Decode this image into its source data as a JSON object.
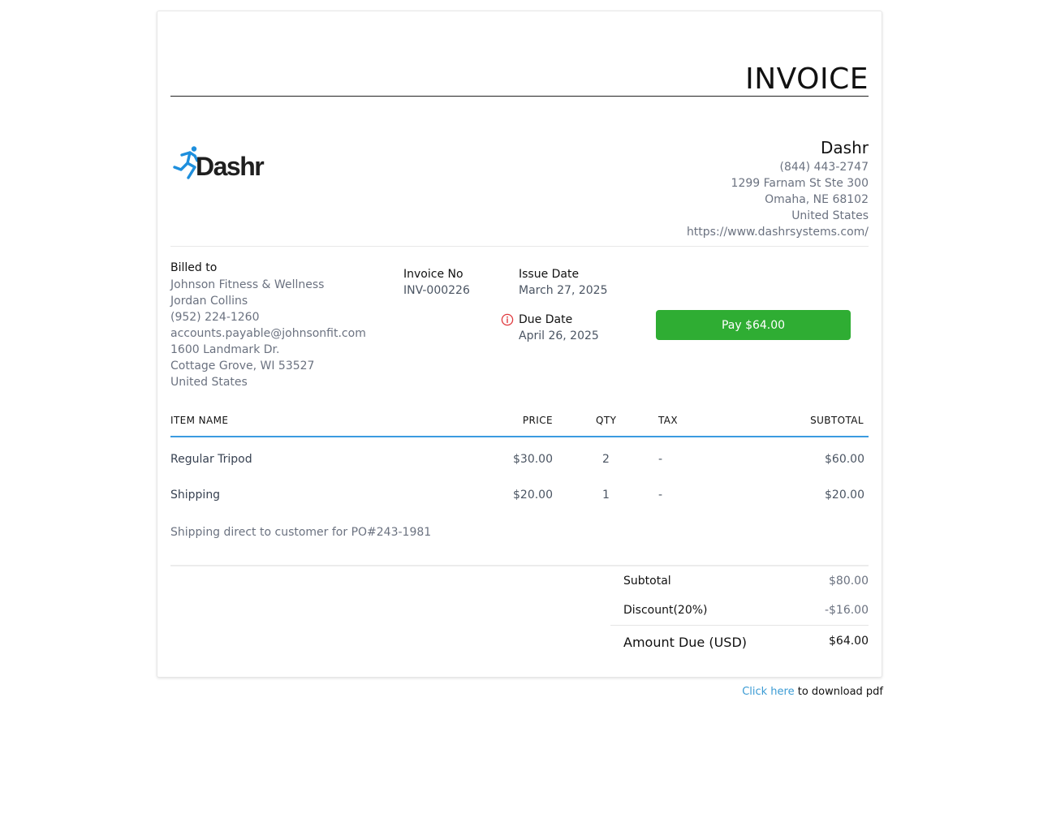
{
  "document": {
    "title": "INVOICE"
  },
  "company": {
    "logo_text": "Dashr",
    "name": "Dashr",
    "phone": "(844) 443-2747",
    "address_line1": "1299 Farnam St Ste 300",
    "address_line2": "Omaha, NE 68102",
    "country": "United States",
    "website": "https://www.dashrsystems.com/"
  },
  "billed_to": {
    "label": "Billed to",
    "company": "Johnson Fitness & Wellness",
    "contact": "Jordan Collins",
    "phone": "(952) 224-1260",
    "email": "accounts.payable@johnsonfit.com",
    "address_line1": "1600 Landmark Dr.",
    "address_line2": "Cottage Grove, WI 53527",
    "country": "United States"
  },
  "invoice": {
    "number_label": "Invoice No",
    "number": "INV-000226",
    "issue_label": "Issue Date",
    "issue_date": "March 27, 2025",
    "due_label": "Due Date",
    "due_date": "April 26, 2025",
    "pay_button": "Pay $64.00"
  },
  "table": {
    "headers": {
      "item": "ITEM NAME",
      "price": "PRICE",
      "qty": "QTY",
      "tax": "TAX",
      "subtotal": "SUBTOTAL"
    },
    "rows": [
      {
        "item": "Regular Tripod",
        "price": "$30.00",
        "qty": "2",
        "tax": "-",
        "subtotal": "$60.00"
      },
      {
        "item": "Shipping",
        "price": "$20.00",
        "qty": "1",
        "tax": "-",
        "subtotal": "$20.00"
      }
    ],
    "note": "Shipping direct to customer for PO#243-1981"
  },
  "totals": {
    "subtotal_label": "Subtotal",
    "subtotal": "$80.00",
    "discount_label": "Discount(20%)",
    "discount": "-$16.00",
    "amount_due_label": "Amount Due (USD)",
    "amount_due": "$64.00"
  },
  "footer": {
    "download_link": "Click here",
    "download_text": " to download pdf"
  },
  "colors": {
    "accent_blue": "#3b9be0",
    "pay_green": "#2fad33",
    "logo_blue": "#1e8fdd",
    "due_icon_red": "#e0393e"
  },
  "icons": {
    "logo_mark": "running-figure-icon",
    "due": "alert-circle-icon"
  }
}
